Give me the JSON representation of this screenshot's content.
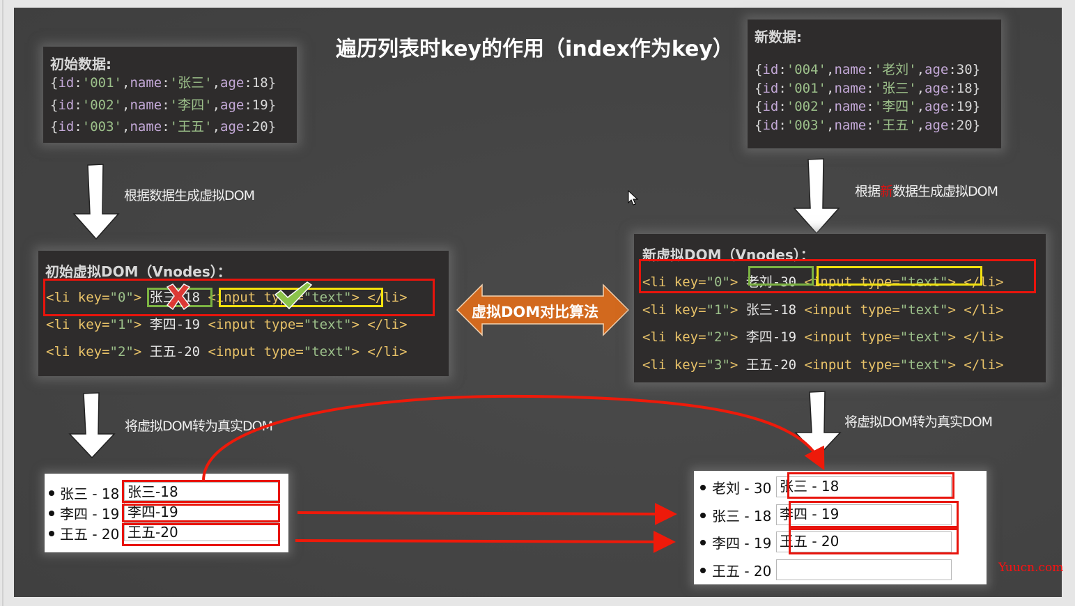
{
  "title": "遍历列表时key的作用（index作为key）",
  "initial_data": {
    "heading": "初始数据:",
    "rows": [
      {
        "id": "001",
        "name": "张三",
        "age": "18"
      },
      {
        "id": "002",
        "name": "李四",
        "age": "19"
      },
      {
        "id": "003",
        "name": "王五",
        "age": "20"
      }
    ]
  },
  "new_data": {
    "heading": "新数据:",
    "rows": [
      {
        "id": "004",
        "name": "老刘",
        "age": "30"
      },
      {
        "id": "001",
        "name": "张三",
        "age": "18"
      },
      {
        "id": "002",
        "name": "李四",
        "age": "19"
      },
      {
        "id": "003",
        "name": "王五",
        "age": "20"
      }
    ]
  },
  "labels": {
    "gen_vdom_left": "根据数据生成虚拟DOM",
    "gen_vdom_right_pre": "根据",
    "gen_vdom_right_mark": "新",
    "gen_vdom_right_post": "数据生成虚拟DOM",
    "to_real_left": "将虚拟DOM转为真实DOM",
    "to_real_right": "将虚拟DOM转为真实DOM",
    "diff_algorithm": "虚拟DOM对比算法"
  },
  "initial_vdom": {
    "heading": "初始虚拟DOM（Vnodes）：",
    "rows": [
      {
        "key": "0",
        "text": "张三-18"
      },
      {
        "key": "1",
        "text": "李四-19"
      },
      {
        "key": "2",
        "text": "王五-20"
      }
    ]
  },
  "new_vdom": {
    "heading": "新虚拟DOM（Vnodes）：",
    "rows": [
      {
        "key": "0",
        "text": "老刘-30"
      },
      {
        "key": "1",
        "text": "张三-18"
      },
      {
        "key": "2",
        "text": "李四-19"
      },
      {
        "key": "3",
        "text": "王五-20"
      }
    ]
  },
  "code_tokens": {
    "li_open": "<li",
    "key_attr": "key=",
    "quote": "\"",
    "gt": ">",
    "input_open": "<input",
    "type_attr": "type=",
    "text_val": "\"text\"",
    "li_close": "</li>"
  },
  "initial_real_dom": {
    "items": [
      {
        "label": "张三 - 18",
        "input_value": "张三-18"
      },
      {
        "label": "李四 - 19",
        "input_value": "李四-19"
      },
      {
        "label": "王五 - 20",
        "input_value": "王五-20"
      }
    ]
  },
  "new_real_dom": {
    "items": [
      {
        "label": "老刘 - 30",
        "input_value": "张三 - 18"
      },
      {
        "label": "张三 - 18",
        "input_value": "李四 - 19"
      },
      {
        "label": "李四 - 19",
        "input_value": "王五 - 20"
      },
      {
        "label": "王五 - 20",
        "input_value": ""
      }
    ]
  },
  "watermark": "Yuucn.com",
  "colors": {
    "highlight_red": "#e8140c",
    "highlight_green": "#7cb342",
    "highlight_yellow": "#f2e20e",
    "diff_arrow": "#d2691e"
  }
}
